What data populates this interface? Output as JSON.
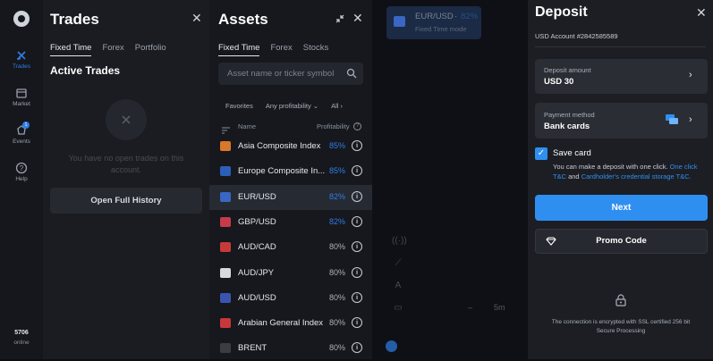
{
  "rail": {
    "items": [
      {
        "label": "Trades",
        "icon": "trades-icon"
      },
      {
        "label": "Market",
        "icon": "market-icon"
      },
      {
        "label": "Events",
        "icon": "events-icon",
        "badge": "1"
      },
      {
        "label": "Help",
        "icon": "help-icon"
      }
    ],
    "online_count": "5706",
    "online_label": "online"
  },
  "trades_panel": {
    "title": "Trades",
    "tabs": [
      "Fixed Time",
      "Forex",
      "Portfolio"
    ],
    "active_title": "Active Trades",
    "empty_text": "You have no open trades on this account.",
    "history_button": "Open Full History"
  },
  "assets_panel": {
    "title": "Assets",
    "tabs": [
      "Fixed Time",
      "Forex",
      "Stocks"
    ],
    "search_placeholder": "Asset name or ticker symbol",
    "filters": [
      "Favorites",
      "Any profitability",
      "All"
    ],
    "col_name": "Name",
    "col_profit": "Profitability",
    "rows": [
      {
        "name": "Asia Composite Index",
        "profit": "85%",
        "highlight": true,
        "flag_color": "#d9782a"
      },
      {
        "name": "Europe Composite In...",
        "profit": "85%",
        "highlight": true,
        "flag_color": "#2c5fb8"
      },
      {
        "name": "EUR/USD",
        "profit": "82%",
        "highlight": true,
        "flag_color": "#3a66c4"
      },
      {
        "name": "GBP/USD",
        "profit": "82%",
        "highlight": true,
        "flag_color": "#c83a4a"
      },
      {
        "name": "AUD/CAD",
        "profit": "80%",
        "highlight": false,
        "flag_color": "#c83a3a"
      },
      {
        "name": "AUD/JPY",
        "profit": "80%",
        "highlight": false,
        "flag_color": "#d8d8e0"
      },
      {
        "name": "AUD/USD",
        "profit": "80%",
        "highlight": false,
        "flag_color": "#3a55b0"
      },
      {
        "name": "Arabian General Index",
        "profit": "80%",
        "highlight": false,
        "flag_color": "#c8383a"
      },
      {
        "name": "BRENT",
        "profit": "80%",
        "highlight": false,
        "flag_color": "#3a3d44"
      }
    ]
  },
  "chart": {
    "pair": "EUR/USD",
    "pair_profit": "82%",
    "mode": "Fixed Time mode",
    "timeframe": "5m",
    "minus": "–"
  },
  "deposit": {
    "title": "Deposit",
    "account": "USD Account #2842585589",
    "amount_label": "Deposit amount",
    "amount_value": "USD 30",
    "method_label": "Payment method",
    "method_value": "Bank cards",
    "save_card": "Save card",
    "note_text": "You can make a deposit with one click.",
    "note_link1": "One click T&C",
    "note_and": "and",
    "note_link2": "Cardholder's credential storage T&C.",
    "next_button": "Next",
    "promo_button": "Promo Code",
    "secure_text": "The connection is encrypted with SSL certified 256 bit Secure Processing"
  },
  "colors": {
    "accent": "#2f8ff0",
    "profit_blue": "#2f7ee6"
  }
}
